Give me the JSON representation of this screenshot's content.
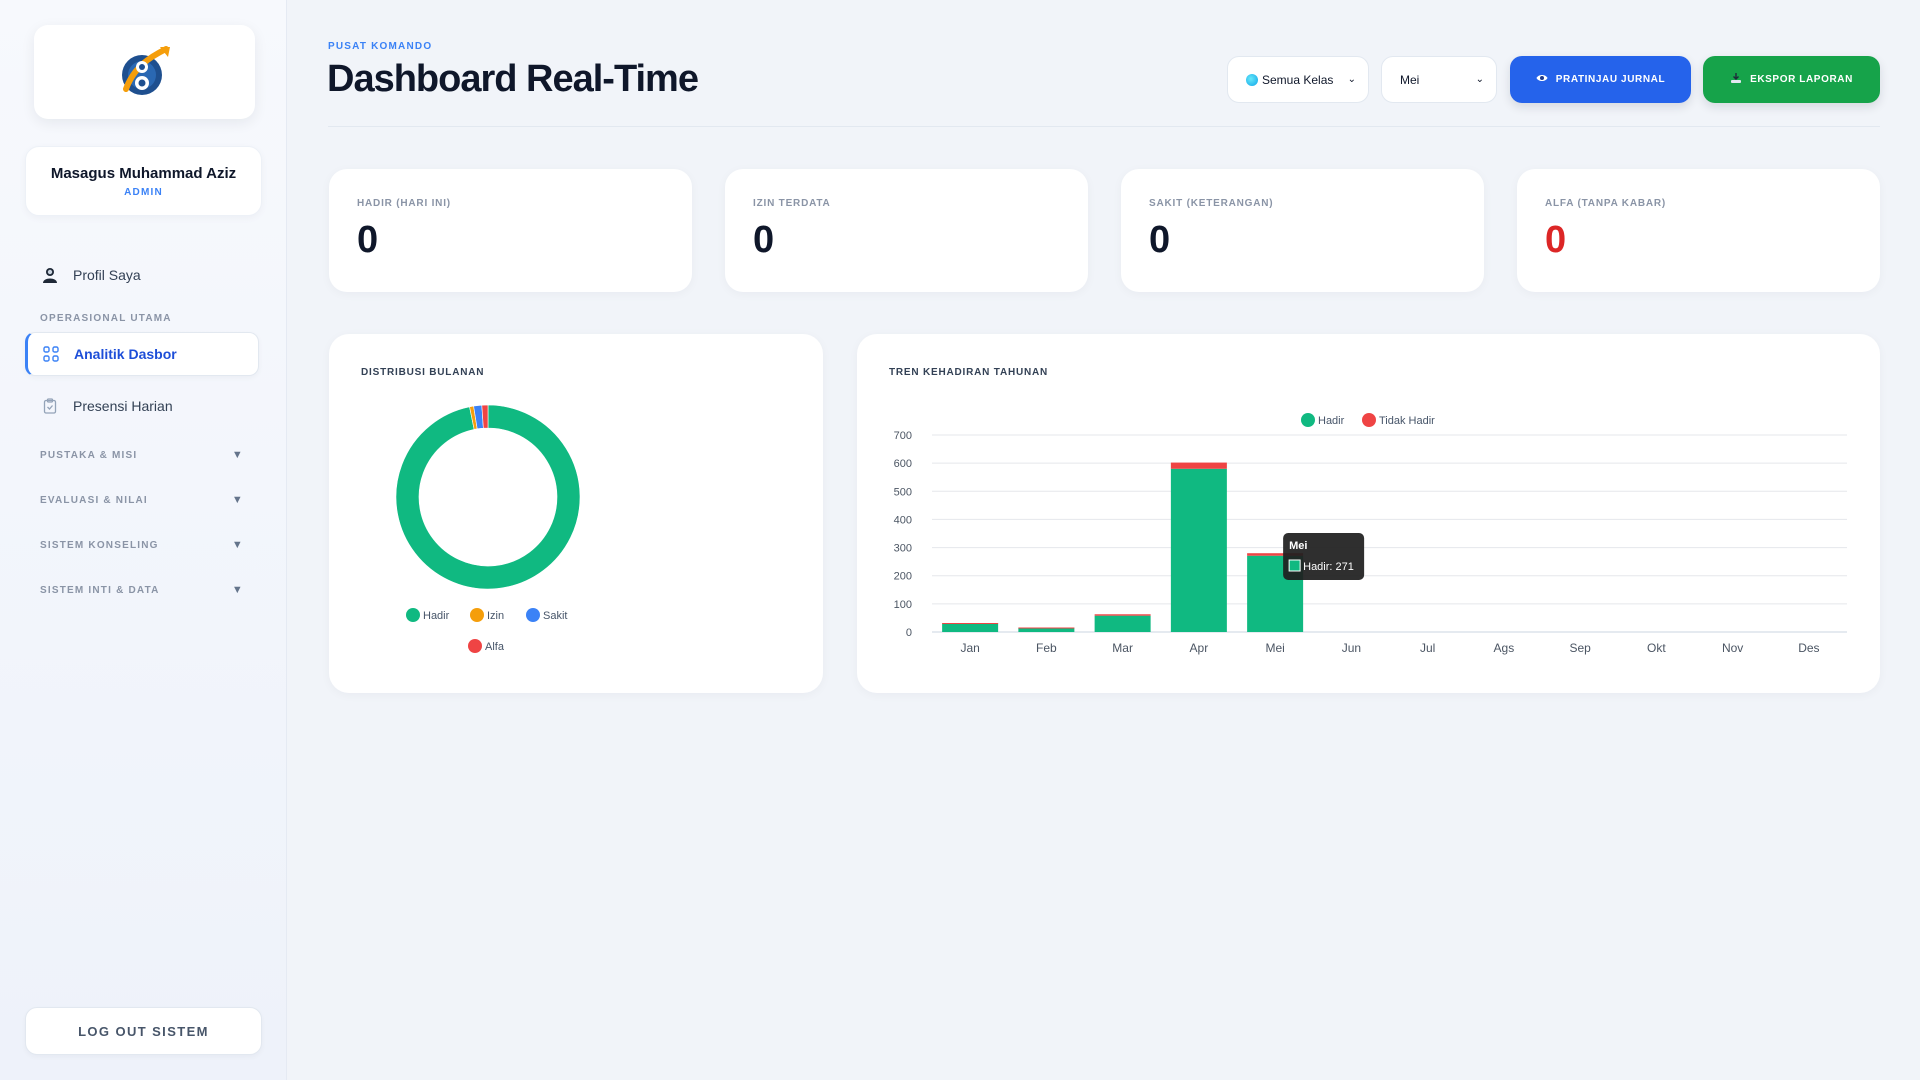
{
  "sidebar": {
    "user": {
      "name": "Masagus Muhammad Aziz",
      "role": "ADMIN"
    },
    "profile_label": "Profil Saya",
    "section_main": "OPERASIONAL UTAMA",
    "items": [
      {
        "label": "Analitik Dasbor",
        "icon": "grid-icon",
        "active": true
      },
      {
        "label": "Presensi Harian",
        "icon": "clipboard-icon",
        "active": false
      }
    ],
    "groups": [
      "PUSTAKA & MISI",
      "EVALUASI & NILAI",
      "SISTEM KONSELING",
      "SISTEM INTI & DATA"
    ],
    "logout_label": "LOG OUT SISTEM"
  },
  "header": {
    "eyebrow": "PUSAT KOMANDO",
    "title": "Dashboard Real-Time",
    "class_select": "Semua Kelas",
    "month_select": "Mei",
    "btn_preview": "PRATINJAU JURNAL",
    "btn_export": "EKSPOR LAPORAN"
  },
  "stats": [
    {
      "label": "HADIR (HARI INI)",
      "value": "0"
    },
    {
      "label": "IZIN TERDATA",
      "value": "0"
    },
    {
      "label": "SAKIT (KETERANGAN)",
      "value": "0"
    },
    {
      "label": "ALFA (TANPA KABAR)",
      "value": "0"
    }
  ],
  "donut": {
    "title": "DISTRIBUSI BULANAN"
  },
  "bar": {
    "title": "TREN KEHADIRAN TAHUNAN",
    "tooltip": {
      "title": "Mei",
      "label": "Hadir: 271"
    }
  },
  "colors": {
    "hadir": "#10b981",
    "izin": "#f59e0b",
    "sakit": "#3b82f6",
    "alfa": "#ef4444",
    "primary": "#2563eb",
    "success": "#16a34a"
  },
  "chart_data": [
    {
      "type": "pie",
      "categories": [
        "Hadir",
        "Izin",
        "Sakit",
        "Alfa"
      ],
      "values": [
        271,
        2,
        4,
        3
      ],
      "legend": "bottom"
    },
    {
      "type": "bar",
      "categories": [
        "Jan",
        "Feb",
        "Mar",
        "Apr",
        "Mei",
        "Jun",
        "Jul",
        "Ags",
        "Sep",
        "Okt",
        "Nov",
        "Des"
      ],
      "series": [
        {
          "name": "Hadir",
          "values": [
            30,
            15,
            58,
            580,
            271,
            0,
            0,
            0,
            0,
            0,
            0,
            0
          ]
        },
        {
          "name": "Tidak Hadir",
          "values": [
            2,
            1,
            5,
            22,
            9,
            0,
            0,
            0,
            0,
            0,
            0,
            0
          ]
        }
      ],
      "stacked": true,
      "ylim": [
        0,
        700
      ],
      "yticks": [
        0,
        100,
        200,
        300,
        400,
        500,
        600,
        700
      ],
      "grid": true,
      "legend": "top"
    }
  ]
}
